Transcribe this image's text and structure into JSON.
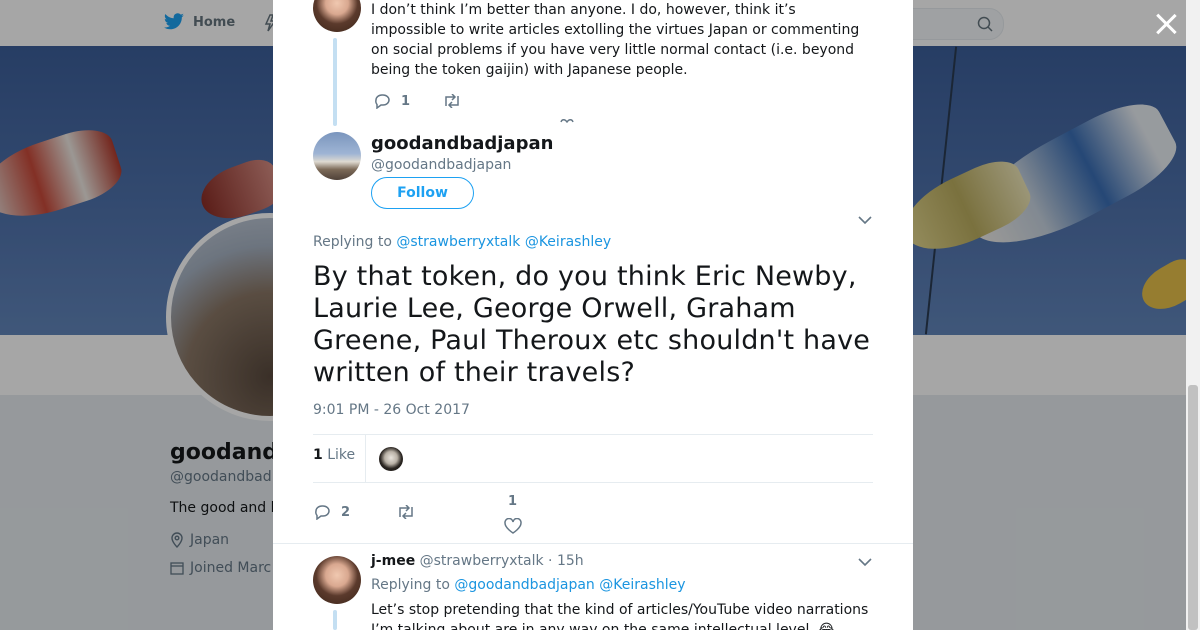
{
  "nav": {
    "home_label": "Home"
  },
  "profile": {
    "name_partial": "goodand",
    "handle_partial": "@goodandbad",
    "bio_partial": "The good and b",
    "location": "Japan",
    "joined_partial": "Joined Marc"
  },
  "thread_top": {
    "text": "I don’t think I’m better than anyone. I do, however, think it’s impossible to write articles extolling the virtues Japan or commenting on social problems if you have very little normal contact (i.e. beyond being the token gaijin) with Japanese people.",
    "reply_count": "1"
  },
  "main_tweet": {
    "name": "goodandbadjapan",
    "handle": "@goodandbadjapan",
    "follow_label": "Follow",
    "replying_prefix": "Replying to",
    "replying_to_1": "@strawberryxtalk",
    "replying_to_2": "@Keirashley",
    "text": "By that token, do you think Eric Newby, Laurie Lee, George Orwell, Graham Greene, Paul Theroux etc shouldn't have written of their travels?",
    "timestamp": "9:01 PM - 26 Oct 2017",
    "likes_number": "1",
    "likes_label": "Like",
    "reply_count": "2",
    "like_count": "1"
  },
  "reply_tweet": {
    "name": "j-mee",
    "handle_time": "@strawberryxtalk · 15h",
    "replying_prefix": "Replying to",
    "replying_to_1": "@goodandbadjapan",
    "replying_to_2": "@Keirashley",
    "text": "Let’s stop pretending that the kind of articles/YouTube video narrations I’m talking about are in any way on the same intellectual level. 😂"
  },
  "colors": {
    "accent": "#1da1f2",
    "link": "#1b95e0",
    "muted": "#657786",
    "thread_line": "#c4dff2"
  }
}
